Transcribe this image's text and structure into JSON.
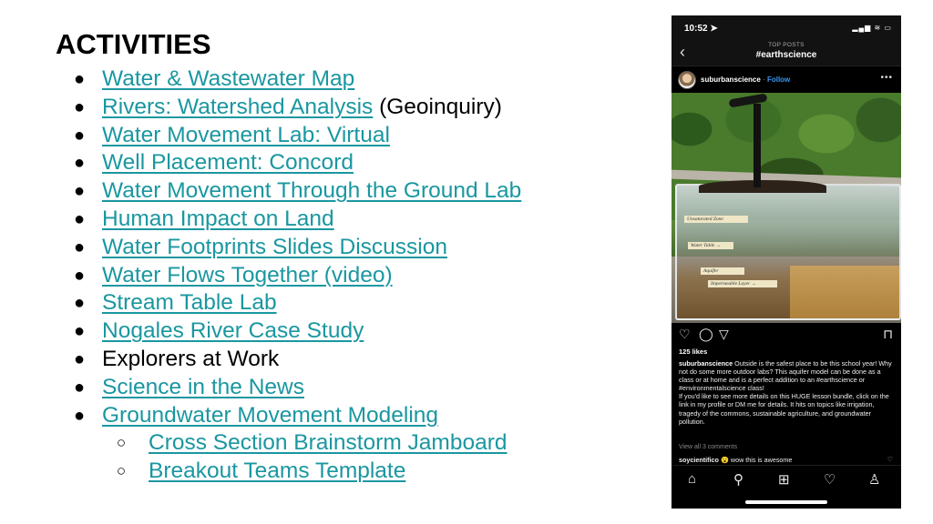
{
  "slide": {
    "title": "ACTIVITIES",
    "colors": {
      "link": "#1a97a0",
      "text": "#000000"
    },
    "items": [
      {
        "label": "Water & Wastewater Map",
        "link": true
      },
      {
        "label": "Rivers: Watershed Analysis",
        "link": true,
        "suffix": " (Geoinquiry)"
      },
      {
        "label": "Water Movement Lab: Virtual",
        "link": true
      },
      {
        "label": "Well Placement: Concord",
        "link": true
      },
      {
        "label": "Water Movement Through the Ground Lab",
        "link": true
      },
      {
        "label": "Human Impact on Land",
        "link": true
      },
      {
        "label": "Water Footprints Slides Discussion",
        "link": true
      },
      {
        "label": "Water Flows Together (video)",
        "link": true
      },
      {
        "label": "Stream Table Lab",
        "link": true
      },
      {
        "label": "Nogales River Case Study",
        "link": true
      },
      {
        "label": "Explorers at Work",
        "link": false
      },
      {
        "label": "Science in the News",
        "link": true
      },
      {
        "label": "Groundwater Movement Modeling",
        "link": true
      }
    ],
    "sub_items": [
      {
        "label": "Cross Section Brainstorm Jamboard",
        "link": true
      },
      {
        "label": "Breakout Teams Template",
        "link": true
      }
    ],
    "bullet": "●",
    "sub_bullet": "○"
  },
  "phone": {
    "status": {
      "time": "10:52 ➤",
      "icons": "▂▄▆ ≋ ▭"
    },
    "nav": {
      "back_icon": "‹",
      "subtitle": "TOP POSTS",
      "title": "#earthscience"
    },
    "post": {
      "username": "suburbanscience",
      "separator": "·",
      "follow": "Follow",
      "more_icon": "•••",
      "photo_labels": [
        "Unsaturated Zone",
        "Water Table →",
        "Aquifer",
        "Impermeable Layer →"
      ],
      "likes": "125 likes",
      "caption_user": "suburbanscience",
      "caption_text": " Outside is the safest place to be this school year!  Why not do some more outdoor labs?  This aquifer model can be done as a class or at home and is a perfect addition to an #earthscience or #environmentalscience class!",
      "caption_text_2": "If you'd like to see more details on this HUGE lesson bundle, click on the link in my profile or DM me for details. It hits on topics like irrigation, tragedy of the commons, sustainable agriculture, and groundwater pollution.",
      "view_comments": "View all 3 comments",
      "comment_user": "soycientifico",
      "comment_emoji": "😮",
      "comment_text": " wow this is awesome",
      "action_icons": {
        "like": "♡",
        "comment": "◯",
        "share": "▽",
        "save": "⊓"
      },
      "comment_like_icon": "♡"
    },
    "tabs": {
      "home": "⌂",
      "search": "⚲",
      "add": "⊞",
      "activity": "♡",
      "profile": "♙"
    }
  }
}
